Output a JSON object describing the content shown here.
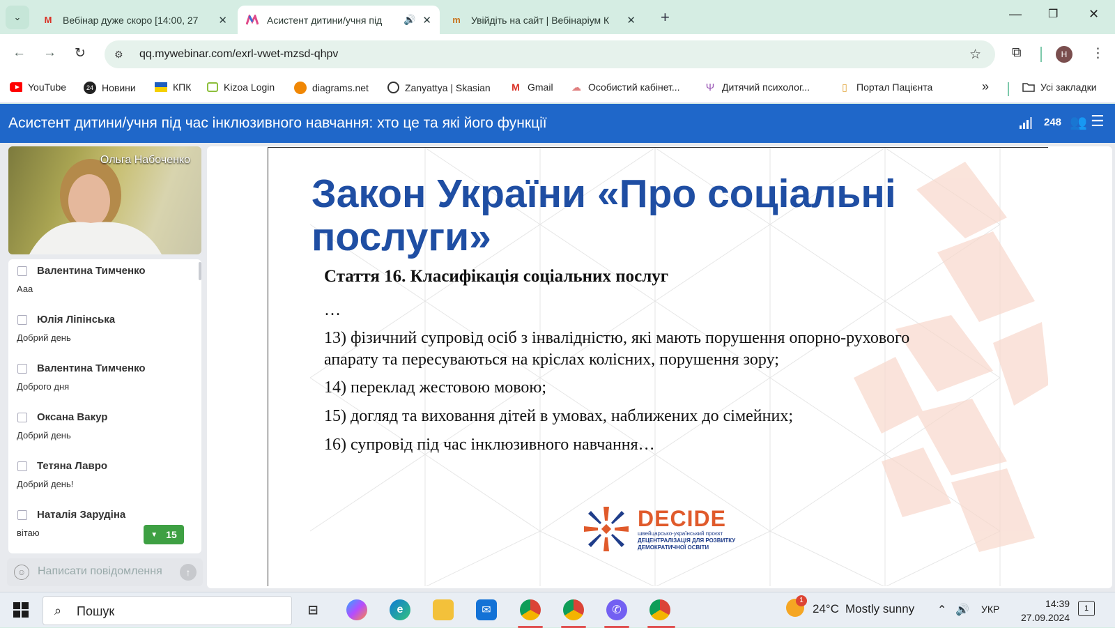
{
  "browser": {
    "tabs": [
      {
        "title": "Вебінар дуже скоро [14:00, 27",
        "icon": "gmail-icon",
        "active": false
      },
      {
        "title": "Асистент дитини/учня під",
        "icon": "mywebinar-icon",
        "active": true,
        "audio": "🔊"
      },
      {
        "title": "Увійдіть на сайт | Вебінаріум К",
        "icon": "webinarium-icon",
        "active": false
      }
    ],
    "close_glyph": "✕",
    "new_tab_glyph": "+",
    "url": "qq.mywebinar.com/exrl-vwet-mzsd-qhpv",
    "profile_initial": "H",
    "bookmarks": [
      {
        "label": "YouTube",
        "color": "#ff0000"
      },
      {
        "label": "Новини",
        "color": "#222222",
        "badge": "24"
      },
      {
        "label": "КПК",
        "color": "#1f5fbf"
      },
      {
        "label": "Kizoa Login",
        "color": "#8dbf3c"
      },
      {
        "label": "diagrams.net",
        "color": "#f08705"
      },
      {
        "label": "Zanyattya | Skasian",
        "color": "#333333"
      },
      {
        "label": "Gmail",
        "color": "#d93025"
      },
      {
        "label": "Особистий кабінет...",
        "color": "#e08080"
      },
      {
        "label": "Дитячий психолог...",
        "color": "#9b59b6"
      },
      {
        "label": "Портал Пацієнта",
        "color": "#e0a030"
      }
    ],
    "more_bookmarks": "»",
    "all_bookmarks": "Усі закладки"
  },
  "webinar": {
    "title": "Асистент дитини/учня під час інклюзивного навчання: хто це та які його функції",
    "participants": "248",
    "presenter": "Ольга Набоченко",
    "chat": [
      {
        "user": "Валентина Тимченко",
        "text": "Ааа"
      },
      {
        "user": "Юлія Ліпінська",
        "text": "Добрий день"
      },
      {
        "user": "Валентина Тимченко",
        "text": "Доброго дня"
      },
      {
        "user": "Оксана Вакур",
        "text": "Добрий день"
      },
      {
        "user": "Тетяна Лавро",
        "text": "Добрий день!"
      },
      {
        "user": "Наталія Зарудіна",
        "text": "вітаю"
      }
    ],
    "new_messages": "15",
    "input_placeholder": "Написати повідомлення"
  },
  "slide": {
    "heading": "Закон України «Про соціальні послуги»",
    "article": "Стаття 16. Класифікація соціальних послуг",
    "ellipsis": "…",
    "items": [
      "13) фізичний супровід осіб з інвалідністю, які мають порушення опорно-рухового апарату та пересуваються на кріслах колісних, порушення зору;",
      "14) переклад жестовою мовою;",
      "15) догляд та виховання дітей в умовах, наближених до сімейних;",
      "16) супровід під час інклюзивного навчання…"
    ],
    "logo_word": "DECIDE",
    "logo_sub": [
      "швейцарсько-український проєкт",
      "ДЕЦЕНТРАЛІЗАЦІЯ ДЛЯ РОЗВИТКУ",
      "ДЕМОКРАТИЧНОЇ ОСВІТИ"
    ]
  },
  "taskbar": {
    "search": "Пошук",
    "weather_temp": "24°C",
    "weather_text": "Mostly sunny",
    "weather_badge": "1",
    "lang": "УКР",
    "time": "14:39",
    "date": "27.09.2024",
    "notif_count": "1"
  },
  "colors": {
    "header": "#1f67c9",
    "heading": "#1f4ea3",
    "accent_orange": "#e05a2b",
    "badge_green": "#3ea043"
  }
}
